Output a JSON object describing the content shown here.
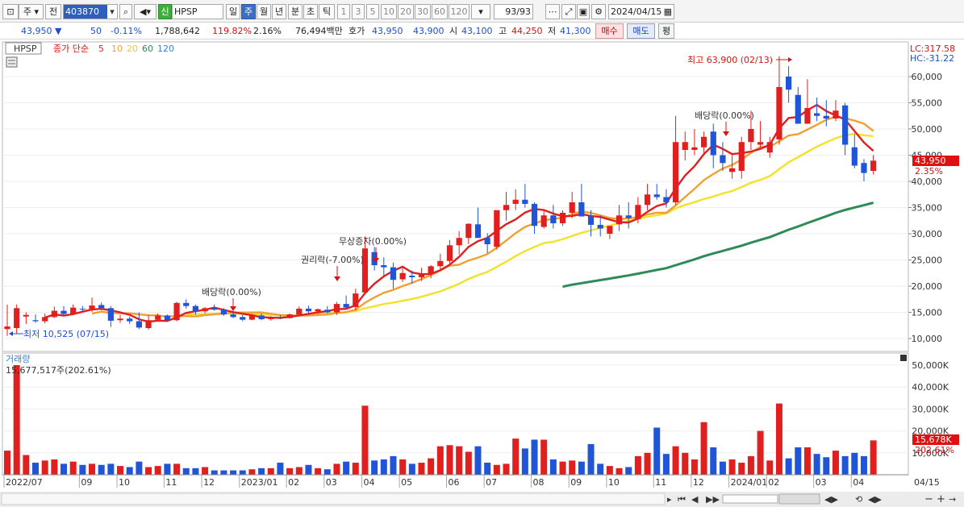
{
  "toolbar": {
    "mode_label": "주",
    "prev_label": "전",
    "stock_code": "403870",
    "new_badge": "신",
    "stock_name": "HPSP",
    "periods": [
      "일",
      "주",
      "월",
      "년",
      "분",
      "초",
      "틱"
    ],
    "selected_period": "주",
    "intervals": [
      "1",
      "3",
      "5",
      "10",
      "20",
      "30",
      "60",
      "120"
    ],
    "count": "93/93",
    "date": "2024/04/15"
  },
  "quote": {
    "price": "43,950",
    "direction": "▼",
    "change": "50",
    "change_pct": "-0.11%",
    "volume": "1,788,642",
    "volume_ratio": "119.82%",
    "turnover": "2.16%",
    "amount": "76,494백만",
    "ask_label": "호가",
    "ask": "43,950",
    "bid": "43,900",
    "open_label": "시",
    "open": "43,100",
    "high_label": "고",
    "high": "44,250",
    "low_label": "저",
    "low": "41,300",
    "buy_label": "매수",
    "sell_label": "매도",
    "eval_label": "평"
  },
  "price_panel": {
    "ticker": "HPSP",
    "ma_label": "종가 단순",
    "ma_periods": [
      "5",
      "10",
      "20",
      "60",
      "120"
    ],
    "ma_colors": [
      "#e02020",
      "#f0a030",
      "#f2e22a",
      "#2e8b57",
      "#3a7fc8"
    ],
    "lc": "LC:317.58",
    "hc": "HC:-31.22",
    "current_price_tag": "43,950",
    "current_pct_tag": "2.35%",
    "max_label": "최고 63,900 (02/13)",
    "min_label": "최저 10,525 (07/15)",
    "annotations": [
      "배당락(0.00%)",
      "권리락(-7.00%)",
      "무상증자(0.00%)",
      "배당락(0.00%)"
    ]
  },
  "volume_panel": {
    "title": "거래량",
    "value_label": "15,677,517주(202.61%)",
    "current_tag": "15,678K",
    "current_pct_tag": "202.61%"
  },
  "x_axis": {
    "labels": [
      "2022/07",
      "09",
      "10",
      "11",
      "12",
      "2023/01",
      "02",
      "03",
      "04",
      "05",
      "06",
      "07",
      "08",
      "09",
      "10",
      "11",
      "12",
      "2024/01",
      "02",
      "03",
      "04"
    ],
    "end_label": "04/15"
  },
  "chart_data": [
    {
      "type": "candlestick",
      "title": "HPSP",
      "ylim": [
        7000,
        65000
      ],
      "y_ticks": [
        "10,000",
        "15,000",
        "20,000",
        "25,000",
        "30,000",
        "35,000",
        "40,000",
        "45,000",
        "50,000",
        "55,000",
        "60,000"
      ],
      "ohlc": [
        [
          11800,
          16500,
          10500,
          12300
        ],
        [
          12000,
          16500,
          11000,
          15800
        ],
        [
          14200,
          15000,
          12800,
          14500
        ],
        [
          13500,
          14600,
          13000,
          13300
        ],
        [
          13300,
          14800,
          12900,
          14100
        ],
        [
          14100,
          16100,
          13900,
          15300
        ],
        [
          15300,
          16200,
          14300,
          14700
        ],
        [
          14700,
          16500,
          14500,
          15900
        ],
        [
          15700,
          16200,
          15100,
          15600
        ],
        [
          15400,
          17800,
          15100,
          16300
        ],
        [
          16400,
          16900,
          15400,
          15800
        ],
        [
          15800,
          16200,
          12200,
          13400
        ],
        [
          13500,
          14500,
          13000,
          13800
        ],
        [
          13800,
          14200,
          12800,
          13300
        ],
        [
          13300,
          15000,
          11800,
          12100
        ],
        [
          12000,
          14500,
          11700,
          13500
        ],
        [
          13600,
          14800,
          13200,
          14400
        ],
        [
          14400,
          14600,
          13300,
          13500
        ],
        [
          13500,
          17000,
          13300,
          16800
        ],
        [
          16800,
          17500,
          15700,
          16200
        ],
        [
          16200,
          16500,
          14500,
          15200
        ],
        [
          15200,
          16000,
          14800,
          15800
        ],
        [
          15800,
          16500,
          15300,
          15500
        ],
        [
          15500,
          15800,
          14300,
          14600
        ],
        [
          14600,
          15100,
          13900,
          14100
        ],
        [
          14100,
          14500,
          13300,
          13600
        ],
        [
          13600,
          14700,
          13500,
          14400
        ],
        [
          14400,
          14800,
          13500,
          13700
        ],
        [
          13700,
          14300,
          13400,
          14100
        ],
        [
          14100,
          14500,
          13700,
          13900
        ],
        [
          13900,
          14800,
          13800,
          14600
        ],
        [
          14600,
          16100,
          14500,
          15700
        ],
        [
          15700,
          16300,
          14900,
          15200
        ],
        [
          15200,
          15700,
          14700,
          15600
        ],
        [
          15500,
          16200,
          14800,
          15000
        ],
        [
          15000,
          17000,
          14500,
          16600
        ],
        [
          16600,
          18200,
          15800,
          15900
        ],
        [
          16000,
          19500,
          15400,
          18600
        ],
        [
          18800,
          29500,
          18500,
          27200
        ],
        [
          26500,
          27500,
          23000,
          24000
        ],
        [
          24000,
          25500,
          22000,
          23600
        ],
        [
          23600,
          24500,
          19500,
          21200
        ],
        [
          21300,
          23500,
          20800,
          22500
        ],
        [
          22000,
          23000,
          20500,
          21700
        ],
        [
          21700,
          23500,
          21000,
          22400
        ],
        [
          22400,
          24000,
          21500,
          23800
        ],
        [
          23800,
          26200,
          23000,
          24800
        ],
        [
          24800,
          28800,
          24000,
          27800
        ],
        [
          27800,
          30500,
          26000,
          29200
        ],
        [
          29200,
          32000,
          28000,
          31900
        ],
        [
          31800,
          35000,
          30500,
          29200
        ],
        [
          29200,
          30100,
          26300,
          28000
        ],
        [
          27500,
          31000,
          27000,
          34500
        ],
        [
          34500,
          38000,
          32500,
          35500
        ],
        [
          35700,
          38500,
          34500,
          36500
        ],
        [
          36500,
          39500,
          35000,
          35700
        ],
        [
          35700,
          36000,
          30000,
          31500
        ],
        [
          31300,
          34500,
          31000,
          33500
        ],
        [
          33500,
          35500,
          31000,
          32000
        ],
        [
          32000,
          34500,
          31500,
          34000
        ],
        [
          34000,
          38000,
          33000,
          36000
        ],
        [
          36000,
          39500,
          33500,
          33300
        ],
        [
          33300,
          34500,
          29500,
          31700
        ],
        [
          31700,
          33500,
          29500,
          31000
        ],
        [
          30000,
          31500,
          29000,
          31500
        ],
        [
          31800,
          35500,
          30500,
          33500
        ],
        [
          33500,
          36000,
          31000,
          33000
        ],
        [
          32800,
          37000,
          32000,
          35500
        ],
        [
          35500,
          39500,
          34500,
          37500
        ],
        [
          37500,
          39500,
          36500,
          37000
        ],
        [
          37000,
          38500,
          35000,
          36000
        ],
        [
          36000,
          52500,
          35500,
          47500
        ],
        [
          46000,
          49500,
          44000,
          47500
        ],
        [
          46000,
          50000,
          45000,
          46500
        ],
        [
          46500,
          49500,
          45000,
          48500
        ],
        [
          49500,
          51000,
          42500,
          45000
        ],
        [
          45000,
          47500,
          42000,
          43500
        ],
        [
          41800,
          45000,
          40500,
          42500
        ],
        [
          42000,
          48500,
          40500,
          47500
        ],
        [
          47500,
          53500,
          46000,
          50000
        ],
        [
          47000,
          51500,
          46500,
          47500
        ],
        [
          45500,
          48500,
          44500,
          47500
        ],
        [
          48000,
          63900,
          47000,
          58000
        ],
        [
          60000,
          62000,
          55000,
          57500
        ],
        [
          56500,
          58000,
          51000,
          51000
        ],
        [
          51000,
          59500,
          51000,
          54000
        ],
        [
          53000,
          56000,
          51500,
          52500
        ],
        [
          52500,
          55500,
          50500,
          52000
        ],
        [
          52000,
          55500,
          51500,
          53500
        ],
        [
          54500,
          55000,
          45000,
          47000
        ],
        [
          46500,
          49000,
          42500,
          43000
        ],
        [
          43500,
          44250,
          40000,
          41600
        ],
        [
          42000,
          45000,
          41300,
          43950
        ]
      ]
    },
    {
      "type": "bar",
      "title": "거래량",
      "ylim": [
        0,
        55000
      ],
      "y_ticks": [
        "10,000K",
        "20,000K",
        "30,000K",
        "40,000K",
        "50,000K"
      ],
      "values": [
        11000,
        50000,
        9000,
        5500,
        6500,
        7000,
        5000,
        6000,
        4500,
        5000,
        4500,
        5000,
        4000,
        3500,
        6000,
        3500,
        4000,
        5000,
        5000,
        3000,
        3000,
        3500,
        2000,
        2000,
        2000,
        2000,
        2500,
        3000,
        3000,
        5500,
        3000,
        3500,
        4500,
        3000,
        2500,
        5000,
        6000,
        5500,
        31500,
        6500,
        7000,
        8500,
        7000,
        5000,
        5500,
        7500,
        13000,
        13500,
        13000,
        10500,
        13000,
        5500,
        4500,
        5000,
        16500,
        12000,
        16000,
        16000,
        7000,
        6000,
        6500,
        6000,
        14000,
        5000,
        4000,
        3000,
        3500,
        8500,
        10000,
        21500,
        9500,
        13000,
        10000,
        7000,
        24000,
        12500,
        6000,
        7000,
        5500,
        8500,
        20000,
        6500,
        32500,
        7500,
        12500,
        12500,
        9500,
        8000,
        11000,
        8500,
        10000,
        8500,
        15678
      ]
    }
  ]
}
